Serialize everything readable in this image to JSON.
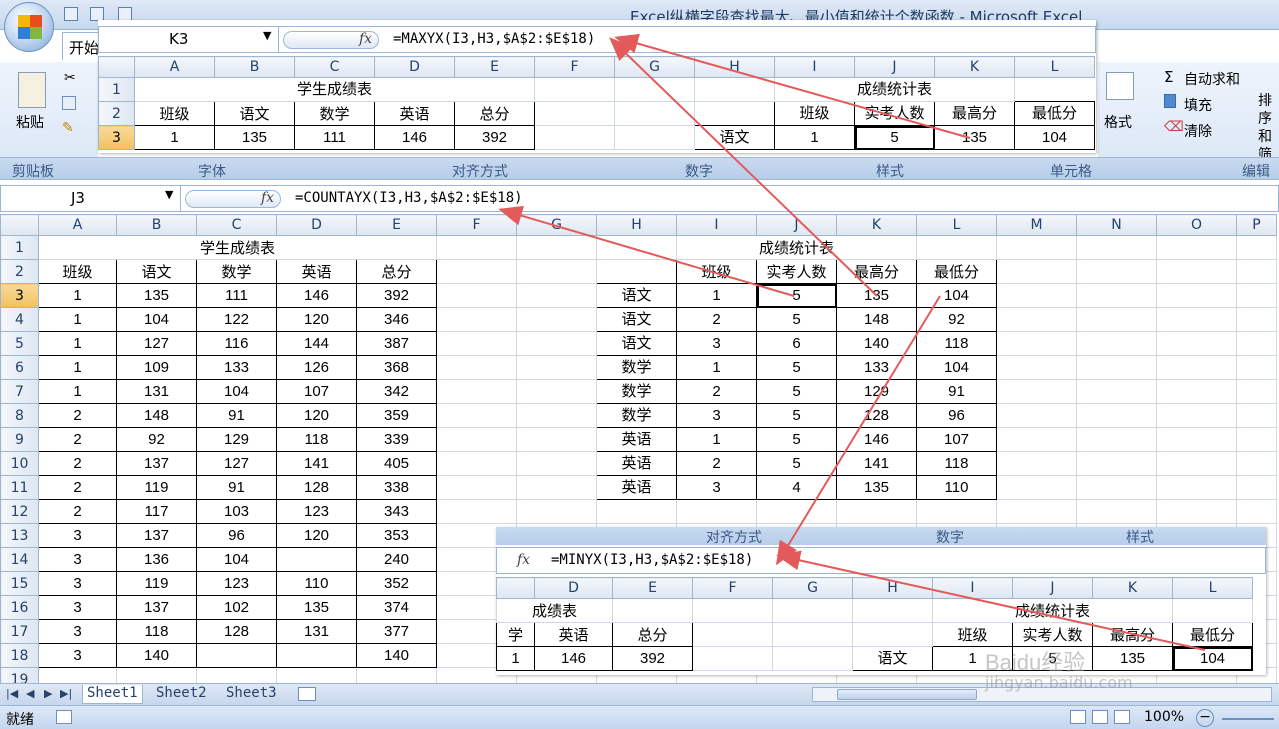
{
  "window": {
    "title": "Excel纵横字段查找最大、最小值和统计个数函数 - Microsoft Excel",
    "tab_home": "开始"
  },
  "ribbon": {
    "clipboard": {
      "paste": "粘贴",
      "group": "剪贴板"
    },
    "groups": [
      "字体",
      "对齐方式",
      "数字",
      "样式",
      "单元格",
      "编辑"
    ],
    "editing": {
      "autosum": "自动求和",
      "fill": "填充",
      "clear": "清除",
      "format": "格式",
      "sort": "排序和筛选"
    }
  },
  "overlay_top": {
    "cell_ref": "K3",
    "formula": "=MAXYX(I3,H3,$A$2:$E$18)",
    "cols": [
      "A",
      "B",
      "C",
      "D",
      "E",
      "F",
      "G",
      "H",
      "I",
      "J",
      "K",
      "L"
    ],
    "rows": [
      [
        "1",
        "学生成绩表",
        "",
        "",
        "",
        "",
        "",
        "",
        "",
        "成绩统计表",
        "",
        ""
      ],
      [
        "2",
        "班级",
        "语文",
        "数学",
        "英语",
        "总分",
        "",
        "",
        "",
        "班级",
        "实考人数",
        "最高分",
        "最低分"
      ],
      [
        "3",
        "1",
        "135",
        "111",
        "146",
        "392",
        "",
        "",
        "语文",
        "1",
        "5",
        "135",
        "104"
      ]
    ]
  },
  "main": {
    "cell_ref": "J3",
    "formula": "=COUNTAYX(I3,H3,$A$2:$E$18)",
    "cols": [
      "A",
      "B",
      "C",
      "D",
      "E",
      "F",
      "G",
      "H",
      "I",
      "J",
      "K",
      "L",
      "M",
      "N",
      "O",
      "P"
    ],
    "title_left": "学生成绩表",
    "title_right": "成绩统计表",
    "left_header": [
      "班级",
      "语文",
      "数学",
      "英语",
      "总分"
    ],
    "left_rows": [
      [
        "1",
        "135",
        "111",
        "146",
        "392"
      ],
      [
        "1",
        "104",
        "122",
        "120",
        "346"
      ],
      [
        "1",
        "127",
        "116",
        "144",
        "387"
      ],
      [
        "1",
        "109",
        "133",
        "126",
        "368"
      ],
      [
        "1",
        "131",
        "104",
        "107",
        "342"
      ],
      [
        "2",
        "148",
        "91",
        "120",
        "359"
      ],
      [
        "2",
        "92",
        "129",
        "118",
        "339"
      ],
      [
        "2",
        "137",
        "127",
        "141",
        "405"
      ],
      [
        "2",
        "119",
        "91",
        "128",
        "338"
      ],
      [
        "2",
        "117",
        "103",
        "123",
        "343"
      ],
      [
        "3",
        "137",
        "96",
        "120",
        "353"
      ],
      [
        "3",
        "136",
        "104",
        "",
        "240"
      ],
      [
        "3",
        "119",
        "123",
        "110",
        "352"
      ],
      [
        "3",
        "137",
        "102",
        "135",
        "374"
      ],
      [
        "3",
        "118",
        "128",
        "131",
        "377"
      ],
      [
        "3",
        "140",
        "",
        "",
        "140"
      ]
    ],
    "right_header": [
      "",
      "班级",
      "实考人数",
      "最高分",
      "最低分"
    ],
    "right_rows": [
      [
        "语文",
        "1",
        "5",
        "135",
        "104"
      ],
      [
        "语文",
        "2",
        "5",
        "148",
        "92"
      ],
      [
        "语文",
        "3",
        "6",
        "140",
        "118"
      ],
      [
        "数学",
        "1",
        "5",
        "133",
        "104"
      ],
      [
        "数学",
        "2",
        "5",
        "129",
        "91"
      ],
      [
        "数学",
        "3",
        "5",
        "128",
        "96"
      ],
      [
        "英语",
        "1",
        "5",
        "146",
        "107"
      ],
      [
        "英语",
        "2",
        "5",
        "141",
        "118"
      ],
      [
        "英语",
        "3",
        "4",
        "135",
        "110"
      ]
    ],
    "row_numbers": [
      "1",
      "2",
      "3",
      "4",
      "5",
      "6",
      "7",
      "8",
      "9",
      "10",
      "11",
      "12",
      "13",
      "14",
      "15",
      "16",
      "17",
      "18",
      "19"
    ]
  },
  "overlay_bottom": {
    "band": [
      "对齐方式",
      "数字",
      "样式"
    ],
    "formula": "=MINYX(I3,H3,$A$2:$E$18)",
    "cols": [
      "D",
      "E",
      "F",
      "G",
      "H",
      "I",
      "J",
      "K",
      "L"
    ],
    "title_left": "成绩表",
    "title_right": "成绩统计表",
    "row2": [
      "学",
      "英语",
      "总分",
      "",
      "",
      "",
      "班级",
      "实考人数",
      "最高分",
      "最低分"
    ],
    "row3": [
      "1",
      "146",
      "392",
      "",
      "",
      "语文",
      "1",
      "5",
      "135",
      "104"
    ]
  },
  "sheets": [
    "Sheet1",
    "Sheet2",
    "Sheet3"
  ],
  "status": {
    "ready": "就绪",
    "zoom": "100%"
  },
  "watermark": "Baidu经验",
  "watermark_url": "jingyan.baidu.com"
}
